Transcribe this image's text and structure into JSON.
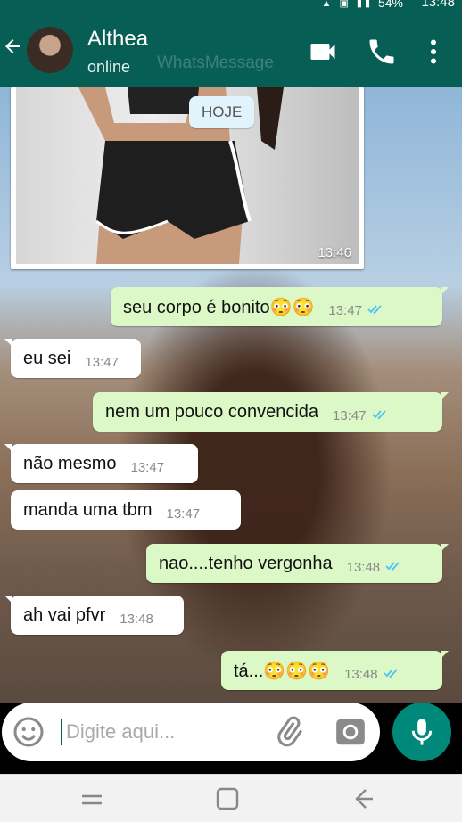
{
  "status_bar": {
    "time": "13:48",
    "battery": "54%"
  },
  "header": {
    "contact_name": "Althea",
    "status": "online",
    "watermark": "WhatsMessage"
  },
  "chat": {
    "date_chip": "HOJE",
    "photo_time": "13:46",
    "messages": [
      {
        "dir": "out",
        "text": "seu corpo é bonito😳😳",
        "time": "13:47"
      },
      {
        "dir": "in",
        "text": "eu sei",
        "time": "13:47"
      },
      {
        "dir": "out",
        "text": "nem um pouco convencida",
        "time": "13:47"
      },
      {
        "dir": "in",
        "text": "não mesmo",
        "time": "13:47"
      },
      {
        "dir": "in",
        "text": "manda uma tbm",
        "time": "13:47"
      },
      {
        "dir": "out",
        "text": "nao....tenho vergonha",
        "time": "13:48"
      },
      {
        "dir": "in",
        "text": "ah vai pfvr",
        "time": "13:48"
      },
      {
        "dir": "out",
        "text": "tá...😳😳😳",
        "time": "13:48"
      }
    ]
  },
  "input": {
    "placeholder": "Digite aqui..."
  },
  "colors": {
    "header": "#075e54",
    "outgoing": "#dcf8c6",
    "incoming": "#ffffff",
    "ticks": "#4fc3f7",
    "mic": "#00897b"
  },
  "icons": [
    "back-arrow-icon",
    "video-call-icon",
    "phone-icon",
    "more-vert-icon",
    "emoji-icon",
    "attach-icon",
    "camera-icon",
    "mic-icon"
  ]
}
